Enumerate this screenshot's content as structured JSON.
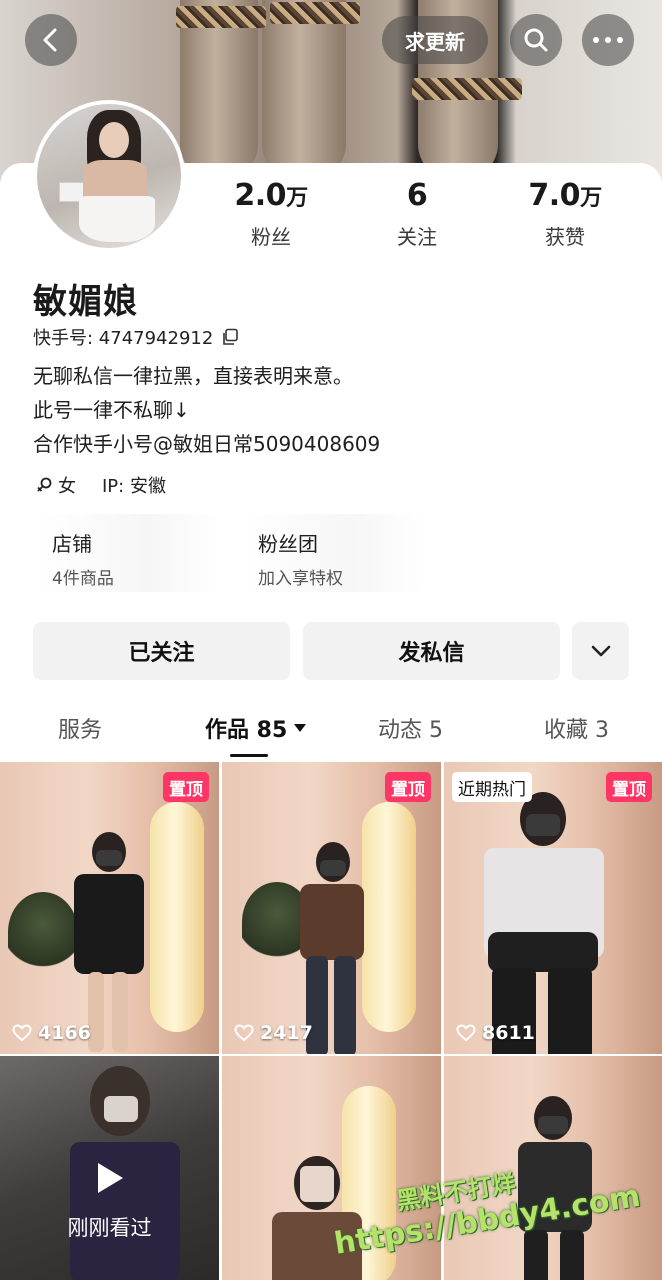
{
  "header": {
    "update_label": "求更新"
  },
  "profile": {
    "name": "敏媚娘",
    "kuaishou_id": "快手号: 4747942912",
    "bio": [
      "无聊私信一律拉黑，直接表明来意。",
      "此号一律不私聊↓",
      "合作快手小号@敏姐日常5090408609"
    ],
    "gender": "女",
    "ip": "IP: 安徽",
    "stats": [
      {
        "value": "2.0",
        "unit": "万",
        "label": "粉丝"
      },
      {
        "value": "6",
        "unit": "",
        "label": "关注"
      },
      {
        "value": "7.0",
        "unit": "万",
        "label": "获赞"
      }
    ]
  },
  "features": [
    {
      "title": "店铺",
      "subtitle": "4件商品"
    },
    {
      "title": "粉丝团",
      "subtitle": "加入享特权"
    }
  ],
  "actions": {
    "follow_label": "已关注",
    "message_label": "发私信"
  },
  "tabs": [
    {
      "label": "服务"
    },
    {
      "label": "作品 85"
    },
    {
      "label": "动态 5"
    },
    {
      "label": "收藏 3"
    }
  ],
  "videos": [
    {
      "badge": "置顶",
      "likes": "4166"
    },
    {
      "badge": "置顶",
      "likes": "2417"
    },
    {
      "badge": "置顶",
      "tag": "近期热门",
      "likes": "8611"
    },
    {
      "overlay": "刚刚看过"
    },
    {},
    {}
  ],
  "watermark": {
    "line1": "黑料不打烊",
    "line2": "https://bbdy4.com"
  },
  "colors": {
    "pin_badge": "#fe3666",
    "button_bg": "#f2f2f2",
    "watermark": "#b7e26a"
  },
  "icons": [
    "back-icon",
    "search-icon",
    "more-icon",
    "copy-icon",
    "female-icon",
    "chevron-down-icon",
    "caret-down-icon",
    "heart-icon",
    "play-icon"
  ]
}
